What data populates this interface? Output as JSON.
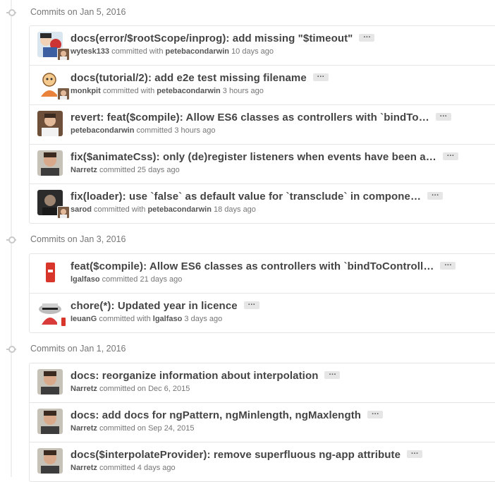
{
  "days": [
    {
      "title": "Commits on Jan 5, 2016",
      "commits": [
        {
          "message": "docs(error/$rootScope/inprog): add missing \"$timeout\"",
          "author": "wytesk133",
          "verb": "committed with",
          "committer": "petebacondarwin",
          "time": "10 days ago",
          "avatar": "avatar-cartoon",
          "small_avatar": "avatar-pete"
        },
        {
          "message": "docs(tutorial/2): add e2e test missing filename",
          "author": "monkpit",
          "verb": "committed with",
          "committer": "petebacondarwin",
          "time": "3 hours ago",
          "avatar": "avatar-monk",
          "small_avatar": "avatar-pete"
        },
        {
          "message": "revert: feat($compile): Allow ES6 classes as controllers with `bindTo…",
          "author": "petebacondarwin",
          "verb": "committed",
          "committer": "",
          "time": "3 hours ago",
          "avatar": "avatar-pete",
          "small_avatar": ""
        },
        {
          "message": "fix($animateCss): only (de)register listeners when events have been a…",
          "author": "Narretz",
          "verb": "committed",
          "committer": "",
          "time": "25 days ago",
          "avatar": "avatar-narretz",
          "small_avatar": ""
        },
        {
          "message": "fix(loader): use `false` as default value for `transclude` in compone…",
          "author": "sarod",
          "verb": "committed with",
          "committer": "petebacondarwin",
          "time": "18 days ago",
          "avatar": "avatar-sarod",
          "small_avatar": "avatar-pete"
        }
      ]
    },
    {
      "title": "Commits on Jan 3, 2016",
      "commits": [
        {
          "message": "feat($compile): Allow ES6 classes as controllers with `bindToControll…",
          "author": "lgalfaso",
          "verb": "committed",
          "committer": "",
          "time": "21 days ago",
          "avatar": "avatar-lgalfaso",
          "small_avatar": ""
        },
        {
          "message": "chore(*): Updated year in licence",
          "author": "IeuanG",
          "verb": "committed with",
          "committer": "lgalfaso",
          "time": "3 days ago",
          "avatar": "avatar-ieuan",
          "small_avatar": "avatar-lgalfaso"
        }
      ]
    },
    {
      "title": "Commits on Jan 1, 2016",
      "commits": [
        {
          "message": "docs: reorganize information about interpolation",
          "author": "Narretz",
          "verb": "committed on",
          "committer": "",
          "time": "Dec 6, 2015",
          "avatar": "avatar-narretz",
          "small_avatar": ""
        },
        {
          "message": "docs: add docs for ngPattern, ngMinlength, ngMaxlength",
          "author": "Narretz",
          "verb": "committed on",
          "committer": "",
          "time": "Sep 24, 2015",
          "avatar": "avatar-narretz",
          "small_avatar": ""
        },
        {
          "message": "docs($interpolateProvider): remove superfluous ng-app attribute",
          "author": "Narretz",
          "verb": "committed",
          "committer": "",
          "time": "4 days ago",
          "avatar": "avatar-narretz",
          "small_avatar": ""
        }
      ]
    }
  ],
  "ellipsis_label": "…"
}
